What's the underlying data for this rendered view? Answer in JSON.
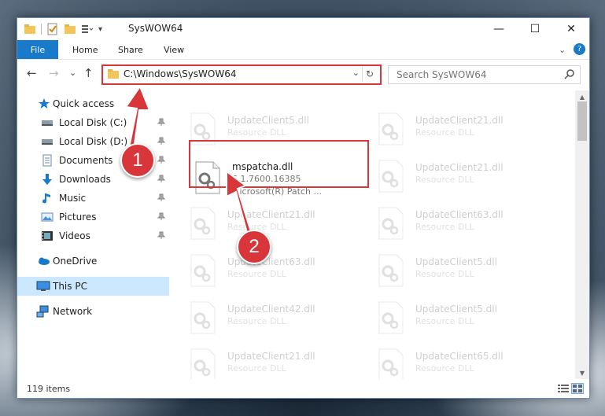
{
  "window": {
    "title": "SysWOW64",
    "minimize": "—",
    "maximize": "☐",
    "close": "✕"
  },
  "ribbon": {
    "file": "File",
    "tabs": [
      "Home",
      "Share",
      "View"
    ],
    "expand": "⌄",
    "help": "?"
  },
  "nav": {
    "back": "←",
    "forward": "→",
    "recent": "⌄",
    "up": "↑",
    "address": "C:\\Windows\\SysWOW64",
    "address_dropdown": "⌄",
    "refresh": "↻",
    "search_placeholder": "Search SysWOW64"
  },
  "sidebar": {
    "items": [
      {
        "label": "Quick access",
        "icon": "star-icon",
        "pinned": false
      },
      {
        "label": "Local Disk (C:)",
        "icon": "drive-icon",
        "pinned": true
      },
      {
        "label": "Local Disk (D:)",
        "icon": "drive-icon",
        "pinned": true
      },
      {
        "label": "Documents",
        "icon": "documents-icon",
        "pinned": true
      },
      {
        "label": "Downloads",
        "icon": "download-icon",
        "pinned": true
      },
      {
        "label": "Music",
        "icon": "music-icon",
        "pinned": true
      },
      {
        "label": "Pictures",
        "icon": "pictures-icon",
        "pinned": true
      },
      {
        "label": "Videos",
        "icon": "videos-icon",
        "pinned": true
      },
      {
        "label": "OneDrive",
        "icon": "cloud-icon",
        "pinned": false
      },
      {
        "label": "This PC",
        "icon": "computer-icon",
        "pinned": false
      },
      {
        "label": "Network",
        "icon": "network-icon",
        "pinned": false
      }
    ],
    "pin_glyph": "📌"
  },
  "files": [
    {
      "name": "UpdateClient5.dll",
      "desc": "Resource DLL"
    },
    {
      "name": "UpdateClient21.dll",
      "desc": "Resource DLL"
    },
    {
      "name": "mspatcha.dll",
      "version": "6.1.7600.16385",
      "desc": "Microsoft(R) Patch ..."
    },
    {
      "name": "UpdateClient21.dll",
      "desc": "Resource DLL"
    },
    {
      "name": "UpdateClient21.dll",
      "desc": "Resource DLL"
    },
    {
      "name": "UpdateClient63.dll",
      "desc": "Resource DLL"
    },
    {
      "name": "UpdateClient63.dll",
      "desc": "Resource DLL"
    },
    {
      "name": "UpdateClient5.dll",
      "desc": "Resource DLL"
    },
    {
      "name": "UpdateClient42.dll",
      "desc": "Resource DLL"
    },
    {
      "name": "UpdateClient5.dll",
      "desc": "Resource DLL"
    },
    {
      "name": "UpdateClient21.dll",
      "desc": "Resource DLL"
    },
    {
      "name": "UpdateClient65.dll",
      "desc": "Resource DLL"
    }
  ],
  "status": {
    "item_count": "119 items"
  },
  "annotations": {
    "step1": "1",
    "step2": "2",
    "color": "#d9363b"
  },
  "colors": {
    "accent": "#1979ca",
    "highlight": "#d9363b",
    "selection": "#cce8ff"
  }
}
